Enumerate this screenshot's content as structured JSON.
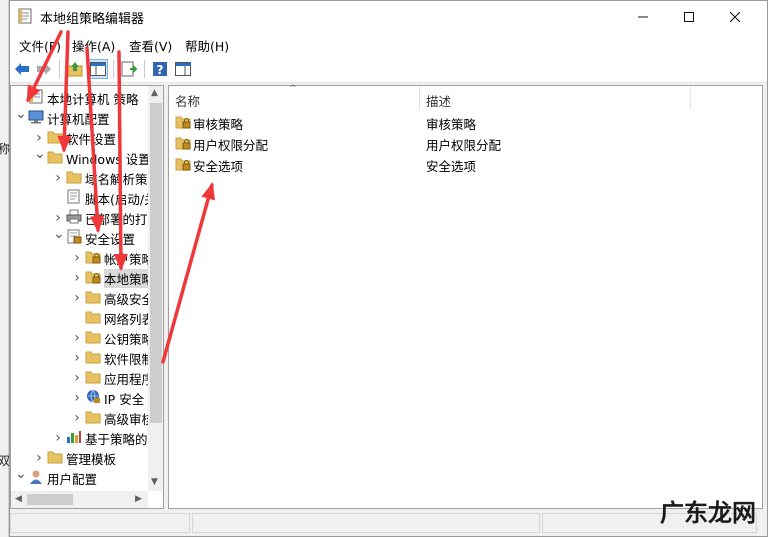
{
  "window": {
    "title": "本地组策略编辑器",
    "minimize_icon": "minimize-icon",
    "maximize_icon": "maximize-icon",
    "close_icon": "close-icon"
  },
  "left_edge": {
    "fragments": [
      "称",
      "双"
    ]
  },
  "menu": {
    "items": [
      "文件(F)",
      "操作(A)",
      "查看(V)",
      "帮助(H)"
    ]
  },
  "toolbar": {
    "icons": [
      "back-arrow-icon",
      "forward-arrow-icon",
      "up-folder-icon",
      "show-hide-tree-icon",
      "export-list-icon",
      "help-icon",
      "properties-pane-icon"
    ]
  },
  "tree": {
    "items": [
      {
        "label": "本地计算机 策略",
        "icon": "policy-document-icon",
        "chevron": ""
      },
      {
        "label": "计算机配置",
        "icon": "computer-icon",
        "chevron": "v"
      },
      {
        "label": "软件设置",
        "icon": "folder-icon",
        "chevron": ">"
      },
      {
        "label": "Windows 设置",
        "icon": "folder-icon",
        "chevron": "v"
      },
      {
        "label": "域名解析策略",
        "icon": "folder-icon",
        "chevron": ">"
      },
      {
        "label": "脚本(启动/关机)",
        "icon": "script-icon",
        "chevron": ""
      },
      {
        "label": "已部署的打印机",
        "icon": "printer-icon",
        "chevron": ">"
      },
      {
        "label": "安全设置",
        "icon": "security-settings-icon",
        "chevron": "v"
      },
      {
        "label": "帐户策略",
        "icon": "locked-folder-icon",
        "chevron": ">"
      },
      {
        "label": "本地策略",
        "icon": "locked-folder-icon",
        "chevron": ">"
      },
      {
        "label": "高级安全",
        "icon": "folder-icon",
        "chevron": ">"
      },
      {
        "label": "网络列表",
        "icon": "folder-icon",
        "chevron": ""
      },
      {
        "label": "公钥策略",
        "icon": "folder-icon",
        "chevron": ">"
      },
      {
        "label": "软件限制",
        "icon": "folder-icon",
        "chevron": ">"
      },
      {
        "label": "应用程序",
        "icon": "folder-icon",
        "chevron": ">"
      },
      {
        "label": "IP 安全",
        "icon": "ip-security-icon",
        "chevron": ">"
      },
      {
        "label": "高级审核",
        "icon": "folder-icon",
        "chevron": ">"
      },
      {
        "label": "基于策略的",
        "icon": "chart-icon",
        "chevron": ">"
      },
      {
        "label": "管理模板",
        "icon": "folder-icon",
        "chevron": ">"
      },
      {
        "label": "用户配置",
        "icon": "user-icon",
        "chevron": "v"
      }
    ]
  },
  "list": {
    "columns": [
      "名称",
      "描述"
    ],
    "rows": [
      {
        "name": "审核策略",
        "description": "审核策略",
        "icon": "locked-folder-icon"
      },
      {
        "name": "用户权限分配",
        "description": "用户权限分配",
        "icon": "locked-folder-icon"
      },
      {
        "name": "安全选项",
        "description": "安全选项",
        "icon": "locked-folder-icon"
      }
    ]
  },
  "watermark": {
    "text": "广东龙网"
  },
  "colors": {
    "annotation_arrow": "#f0383a",
    "folder": "#e8c262",
    "folder_dark": "#c9a23e",
    "lock": "#c08a1c",
    "toolbar_blue": "#2a6fc6",
    "help_blue": "#3465b0"
  }
}
